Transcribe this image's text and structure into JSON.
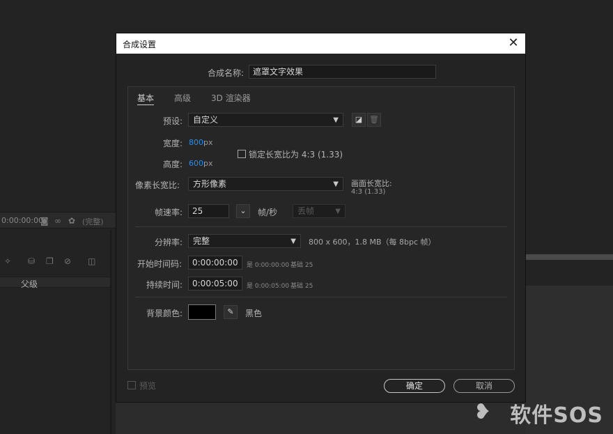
{
  "background": {
    "timecode": "0:00:00:00",
    "complete_label": "(完整)",
    "parent_column": "父级"
  },
  "dialog": {
    "title": "合成设置",
    "name_label": "合成名称:",
    "name_value": "遮罩文字效果",
    "tabs": [
      "基本",
      "高级",
      "3D 渲染器"
    ],
    "preset_label": "预设:",
    "preset_value": "自定义",
    "width_label": "宽度:",
    "width_value": "800",
    "height_label": "高度:",
    "height_value": "600",
    "px_unit": "px",
    "lock_label": "锁定长宽比为 4:3 (1.33)",
    "pixel_aspect_label": "像素长宽比:",
    "pixel_aspect_value": "方形像素",
    "frame_aspect_label": "画面长宽比:",
    "frame_aspect_value": "4:3 (1.33)",
    "framerate_label": "帧速率:",
    "framerate_value": "25",
    "fps_unit": "帧/秒",
    "drop_frame": "丢帧",
    "resolution_label": "分辨率:",
    "resolution_value": "完整",
    "resolution_info": "800 x 600，1.8 MB（每 8bpc 帧）",
    "start_tc_label": "开始时间码:",
    "start_tc_value": "0:00:00:00",
    "start_tc_info": "是 0:00:00:00",
    "start_base": "基础 25",
    "duration_label": "持续时间:",
    "duration_value": "0:00:05:00",
    "duration_info": "是 0:00:05:00",
    "duration_base": "基础 25",
    "bgcolor_label": "背景颜色:",
    "bgcolor_name": "黑色",
    "bgcolor_hex": "#000000",
    "preview_label": "预览",
    "ok_label": "确定",
    "cancel_label": "取消"
  },
  "watermark": {
    "text": "软件SOS"
  }
}
